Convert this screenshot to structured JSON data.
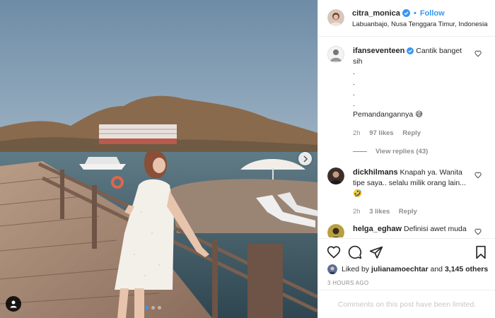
{
  "post": {
    "username": "citra_monica",
    "follow_label": "Follow",
    "separator": "•",
    "location": "Labuanbajo, Nusa Tenggara Timur, Indonesia"
  },
  "comments": [
    {
      "username": "ifanseventeen",
      "verified": true,
      "text": "Cantik banget sih\n.\n.\n.\n.\nPemandangannya 😅",
      "time": "2h",
      "likes": "97 likes",
      "reply_label": "Reply",
      "view_replies": "View replies (43)"
    },
    {
      "username": "dickhilmans",
      "verified": false,
      "text": "Knapah ya. Wanita tipe saya.. selalu milik orang lain... 🤣",
      "time": "2h",
      "likes": "3 likes",
      "reply_label": "Reply"
    },
    {
      "username": "helga_eghaw",
      "verified": false,
      "text": "Definisi awet muda"
    }
  ],
  "liked_by": {
    "prefix": "Liked by",
    "user": "julianamoechtar",
    "conjunction": "and",
    "others": "3,145 others"
  },
  "time_ago": "3 HOURS AGO",
  "comments_limited": "Comments on this post have been limited.",
  "icons": {
    "like": "heart-icon",
    "comment": "comment-icon",
    "share": "paper-plane-icon",
    "save": "bookmark-icon",
    "next": "chevron-right-icon",
    "tag": "user-tag-icon"
  },
  "colors": {
    "accent": "#3897f0",
    "text": "#262626",
    "muted": "#8e8e8e",
    "border": "#efefef"
  },
  "carousel": {
    "pages": 3,
    "active": 1
  }
}
